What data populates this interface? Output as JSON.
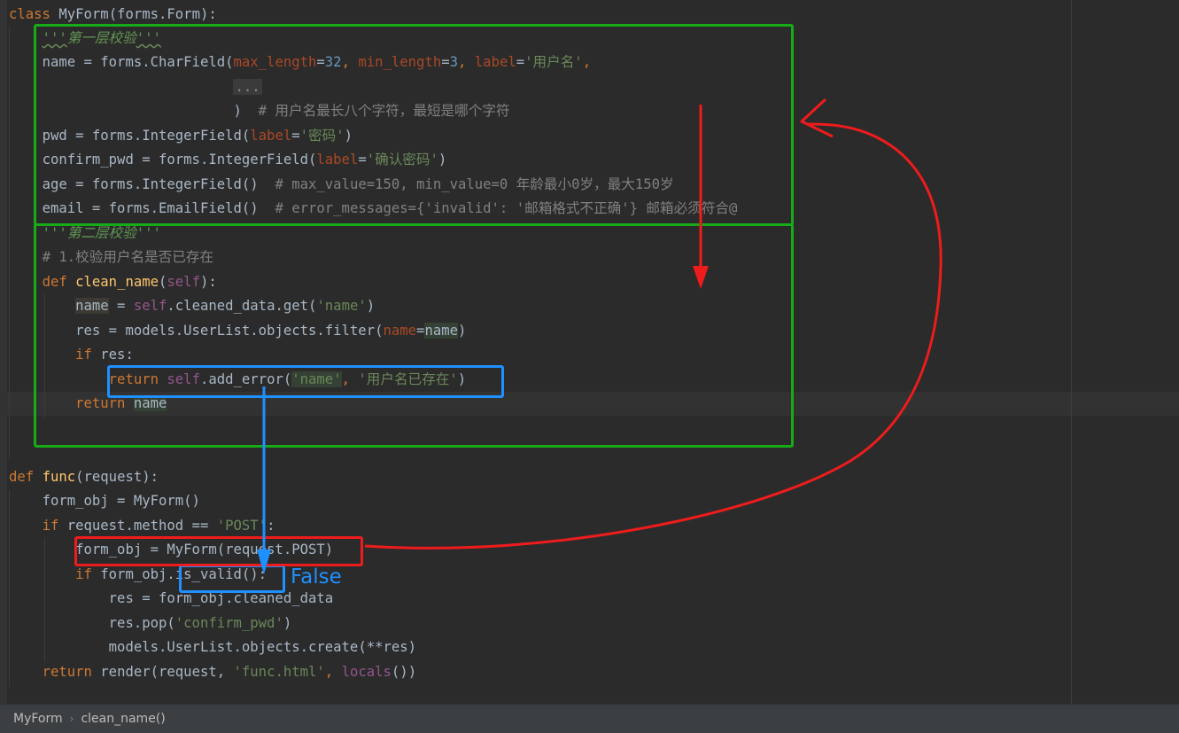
{
  "code": {
    "line01": {
      "a": "class",
      "b": "MyForm",
      "c": "(forms.Form):"
    },
    "line02": {
      "q1": "'''",
      "doc": "第一层校验",
      "q2": "'''"
    },
    "line03": {
      "a": "name = forms.CharField(",
      "p1": "max_length",
      "eq1": "=",
      "n1": "32",
      "c1": ", ",
      "p2": "min_length",
      "eq2": "=",
      "n2": "3",
      "c2": ", ",
      "p3": "label",
      "eq3": "=",
      "s1": "'用户名'",
      "c3": ","
    },
    "line04": {
      "fold": "..."
    },
    "line05": {
      "a": ")",
      "cm": "  # 用户名最长八个字符，最短是哪个字符"
    },
    "line06": {
      "a": "pwd = forms.IntegerField(",
      "p": "label",
      "eq": "=",
      "s": "'密码'",
      "b": ")"
    },
    "line07": {
      "a": "confirm_pwd = forms.IntegerField(",
      "p": "label",
      "eq": "=",
      "s": "'确认密码'",
      "b": ")"
    },
    "line08": {
      "a": "age = forms.IntegerField()",
      "cm": "  # max_value=150, min_value=0 年龄最小0岁，最大150岁"
    },
    "line09": {
      "a": "email = forms.EmailField()",
      "cm": "  # error_messages={'invalid': '邮箱格式不正确'} 邮箱必须符合@"
    },
    "line10": {
      "doc": "'''第二层校验'''"
    },
    "line11": {
      "cm": "# 1.校验用户名是否已存在"
    },
    "line12": {
      "k": "def",
      "fn": "clean_name",
      "a": "(",
      "self": "self",
      "b": "):"
    },
    "line13": {
      "v": "name",
      "a": " = ",
      "self": "self",
      "b": ".cleaned_data.get(",
      "s": "'name'",
      "c": ")"
    },
    "line14": {
      "a": "res = models.UserList.objects.filter(",
      "p": "name",
      "eq": "=",
      "v": "name",
      "b": ")"
    },
    "line15": {
      "k": "if",
      "a": " res:"
    },
    "line16": {
      "k": "return",
      "self": "self",
      "a": ".add_error(",
      "s1": "'name'",
      "c": ", ",
      "s2": "'用户名已存在'",
      "b": ")"
    },
    "line17": {
      "k": "return",
      "v": "name"
    },
    "line18": {
      "k": "def",
      "fn": "func",
      "a": "(request):"
    },
    "line19": {
      "a": "form_obj = MyForm()"
    },
    "line20": {
      "k": "if",
      "a": " request.method == ",
      "s": "'POST'",
      "b": ":"
    },
    "line21": {
      "a": "form_obj = MyForm(request.POST)"
    },
    "line22": {
      "k": "if",
      "a": " form_obj.is_valid():"
    },
    "line23": {
      "a": "res = form_obj.cleaned_data"
    },
    "line24": {
      "a": "res.pop(",
      "s": "'confirm_pwd'",
      "b": ")"
    },
    "line25": {
      "a": "models.UserList.objects.create(**res)"
    },
    "line26": {
      "k": "return",
      "a": " render(request, ",
      "s": "'func.html'",
      "c": ", ",
      "fn": "locals",
      "b": "())"
    }
  },
  "annotations": {
    "false_label": "False",
    "colors": {
      "green": "#17ab17",
      "blue": "#1e90ff",
      "red": "#ee1c1c"
    }
  },
  "breadcrumbs": {
    "items": [
      "MyForm",
      "clean_name()"
    ],
    "separator": "›"
  }
}
